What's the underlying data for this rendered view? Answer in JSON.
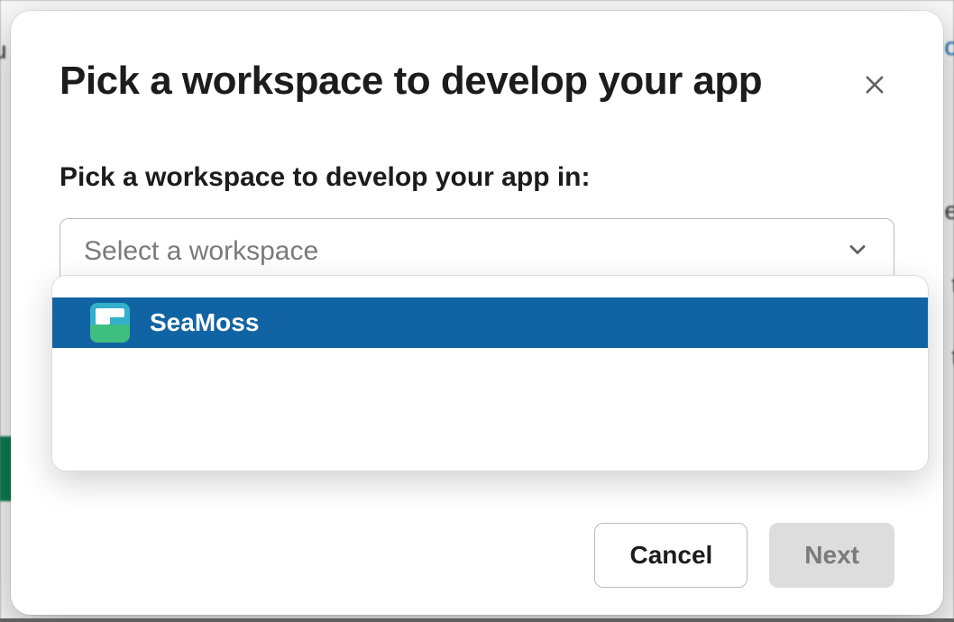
{
  "modal": {
    "title": "Pick a workspace to develop your app",
    "field_label": "Pick a workspace to develop your app in:",
    "select": {
      "placeholder": "Select a workspace",
      "options": [
        {
          "name": "SeaMoss",
          "highlighted": true
        }
      ]
    },
    "buttons": {
      "cancel": "Cancel",
      "next": "Next"
    }
  }
}
